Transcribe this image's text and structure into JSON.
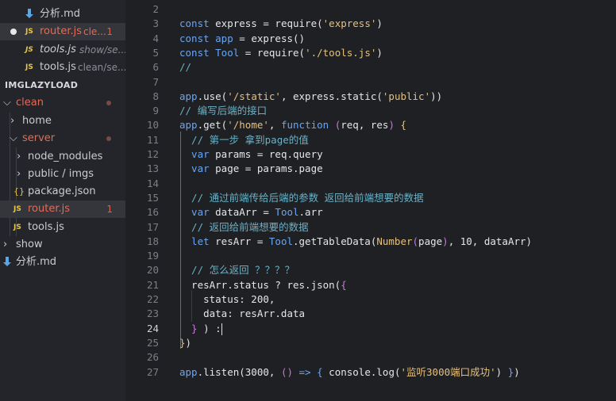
{
  "sidebar": {
    "section_title": "IMGLAZYLOAD",
    "open_editors": [
      {
        "label": "分析.md",
        "desc": "",
        "badge": ""
      },
      {
        "label": "router.js",
        "desc": "cle...",
        "badge": "1"
      },
      {
        "label": "tools.js",
        "desc": "show/se...",
        "badge": ""
      },
      {
        "label": "tools.js",
        "desc": "clean/se...",
        "badge": ""
      }
    ],
    "tree": [
      {
        "label": "clean"
      },
      {
        "label": "home"
      },
      {
        "label": "server"
      },
      {
        "label": "node_modules"
      },
      {
        "label": "public / imgs"
      },
      {
        "label": "package.json"
      },
      {
        "label": "router.js",
        "badge": "1"
      },
      {
        "label": "tools.js"
      },
      {
        "label": "show"
      },
      {
        "label": "分析.md"
      }
    ],
    "icons": {
      "js": "JS",
      "json": "{}"
    }
  },
  "editor": {
    "active_line": "24",
    "lines": [
      {
        "n": "2",
        "tokens": []
      },
      {
        "n": "3",
        "tokens": [
          [
            "kw",
            "const "
          ],
          [
            "",
            "express = "
          ],
          [
            "fn",
            "require"
          ],
          [
            "",
            "("
          ],
          [
            "str",
            "'express'"
          ],
          [
            "",
            ")"
          ]
        ]
      },
      {
        "n": "4",
        "tokens": [
          [
            "kw",
            "const "
          ],
          [
            "kw",
            "app"
          ],
          [
            "",
            " = "
          ],
          [
            "fn",
            "express"
          ],
          [
            "",
            "()"
          ]
        ]
      },
      {
        "n": "5",
        "tokens": [
          [
            "kw",
            "const "
          ],
          [
            "kw",
            "Tool"
          ],
          [
            "",
            " = "
          ],
          [
            "fn",
            "require"
          ],
          [
            "",
            "("
          ],
          [
            "str",
            "'./tools.js'"
          ],
          [
            "",
            ")"
          ]
        ]
      },
      {
        "n": "6",
        "tokens": [
          [
            "cmt",
            "//"
          ]
        ]
      },
      {
        "n": "7",
        "tokens": []
      },
      {
        "n": "8",
        "tokens": [
          [
            "kw",
            "app"
          ],
          [
            "",
            ".use("
          ],
          [
            "str",
            "'/static'"
          ],
          [
            "",
            ", express.static("
          ],
          [
            "str",
            "'public'"
          ],
          [
            "",
            "))"
          ]
        ]
      },
      {
        "n": "9",
        "tokens": [
          [
            "cmt",
            "// 编写后端的接口"
          ]
        ]
      },
      {
        "n": "10",
        "tokens": [
          [
            "kw",
            "app"
          ],
          [
            "",
            ".get("
          ],
          [
            "str",
            "'/home'"
          ],
          [
            "",
            ", "
          ],
          [
            "kw",
            "function"
          ],
          [
            "",
            " "
          ],
          [
            "paren",
            "("
          ],
          [
            "",
            "req, res"
          ],
          [
            "paren",
            ")"
          ],
          [
            "",
            " "
          ],
          [
            "brace1",
            "{"
          ]
        ]
      },
      {
        "n": "11",
        "tokens": [
          [
            "cmt",
            "  // 第一步 拿到page的值"
          ]
        ]
      },
      {
        "n": "12",
        "tokens": [
          [
            "",
            ""
          ],
          [
            "kw",
            "  var "
          ],
          [
            "",
            "params = req.query"
          ]
        ]
      },
      {
        "n": "13",
        "tokens": [
          [
            "kw",
            "  var "
          ],
          [
            "",
            "page = params.page"
          ]
        ]
      },
      {
        "n": "14",
        "tokens": []
      },
      {
        "n": "15",
        "tokens": [
          [
            "cmt",
            "  // 通过前端传给后端的参数 返回给前端想要的数据"
          ]
        ]
      },
      {
        "n": "16",
        "tokens": [
          [
            "kw",
            "  var "
          ],
          [
            "",
            "dataArr = "
          ],
          [
            "kw",
            "Tool"
          ],
          [
            "",
            ".arr"
          ]
        ]
      },
      {
        "n": "17",
        "tokens": [
          [
            "cmt",
            "  // 返回给前端想要的数据"
          ]
        ]
      },
      {
        "n": "18",
        "tokens": [
          [
            "kw",
            "  let "
          ],
          [
            "",
            "resArr = "
          ],
          [
            "kw",
            "Tool"
          ],
          [
            "",
            ".getTableData("
          ],
          [
            "ty",
            "Number"
          ],
          [
            "paren",
            "("
          ],
          [
            "",
            "page"
          ],
          [
            "paren",
            ")"
          ],
          [
            "",
            ", 10, dataArr)"
          ]
        ]
      },
      {
        "n": "19",
        "tokens": []
      },
      {
        "n": "20",
        "tokens": [
          [
            "cmt",
            "  // 怎么返回 ？？？？"
          ]
        ]
      },
      {
        "n": "21",
        "tokens": [
          [
            "",
            "  resArr.status ? res.json("
          ],
          [
            "brace2",
            "{"
          ]
        ]
      },
      {
        "n": "22",
        "tokens": [
          [
            "",
            "    status: 200,"
          ]
        ]
      },
      {
        "n": "23",
        "tokens": [
          [
            "",
            "    data: resArr.data"
          ]
        ]
      },
      {
        "n": "24",
        "tokens": [
          [
            "brace2",
            "  }"
          ],
          [
            "",
            " ) :"
          ]
        ]
      },
      {
        "n": "25",
        "tokens": [
          [
            "brace1",
            "}"
          ],
          [
            "",
            ")"
          ]
        ]
      },
      {
        "n": "26",
        "tokens": []
      },
      {
        "n": "27",
        "tokens": [
          [
            "kw",
            "app"
          ],
          [
            "",
            ".listen(3000, "
          ],
          [
            "paren",
            "()"
          ],
          [
            "",
            " "
          ],
          [
            "kw",
            "=>"
          ],
          [
            "",
            " "
          ],
          [
            "kw",
            "{"
          ],
          [
            "",
            " console.log("
          ],
          [
            "str",
            "'监听3000端口成功'"
          ],
          [
            "",
            ") "
          ],
          [
            "kw",
            "}"
          ],
          [
            "",
            ")"
          ]
        ]
      }
    ]
  }
}
